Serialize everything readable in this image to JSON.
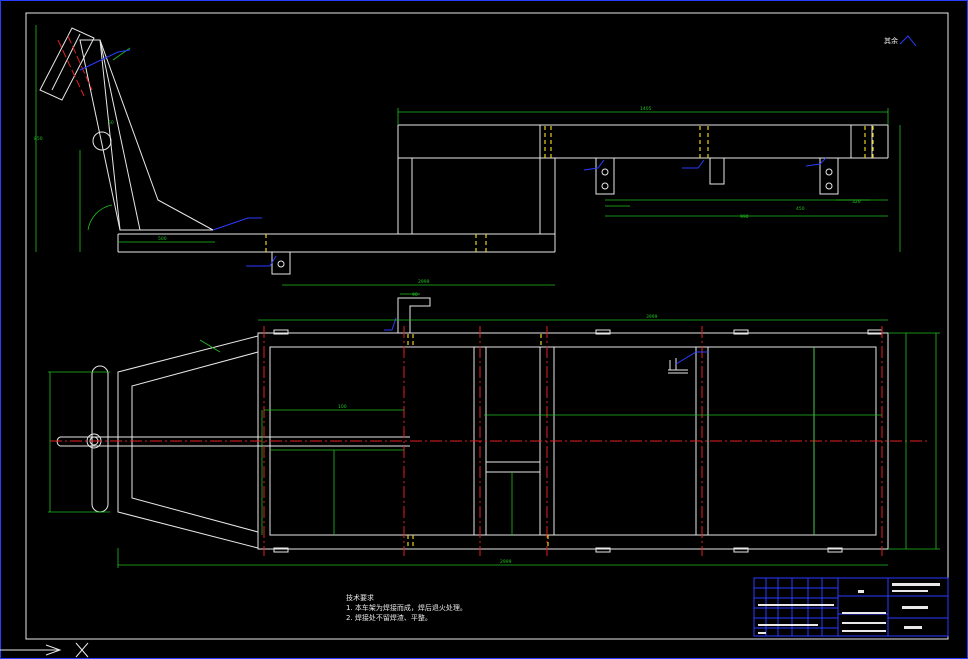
{
  "drawing": {
    "corner_label": "其余",
    "tech_requirements": {
      "heading": "技术要求",
      "items": [
        "1. 本车架为焊接而成，焊后退火处理。",
        "2. 焊接处不留焊渣、平整。"
      ]
    },
    "dimensions": {
      "top_view_overall": "1405",
      "plan_overall": "3999",
      "plan_bottom": "2999",
      "bottom_left": "2999",
      "side_height": "850",
      "side_width": "500",
      "pin_dims": [
        "90",
        "100",
        "50"
      ],
      "right_spacing_1": "450",
      "right_spacing_2": "990",
      "right_spacing_3": "320"
    },
    "colors": {
      "background": "#000000",
      "outline": "#e8e8e8",
      "dimension": "#22c022",
      "centerline": "#e02020",
      "symbol": "#2a3cff",
      "hidden": "#e8d020"
    }
  }
}
